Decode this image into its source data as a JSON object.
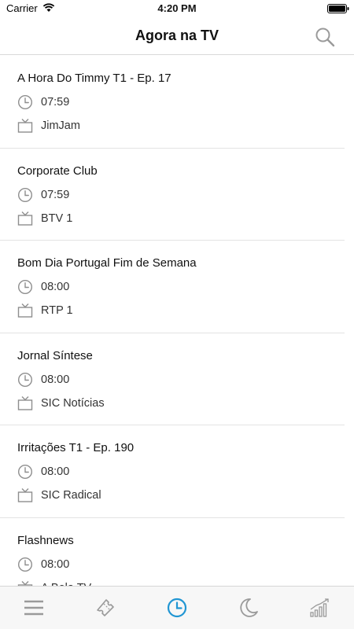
{
  "status_bar": {
    "carrier": "Carrier",
    "time": "4:20 PM"
  },
  "header": {
    "title": "Agora na TV",
    "search_icon": "search-icon"
  },
  "programs": [
    {
      "title": "A Hora Do Timmy T1 - Ep. 17",
      "time": "07:59",
      "channel": "JimJam"
    },
    {
      "title": "Corporate Club",
      "time": "07:59",
      "channel": "BTV 1"
    },
    {
      "title": "Bom Dia Portugal Fim de Semana",
      "time": "08:00",
      "channel": "RTP 1"
    },
    {
      "title": "Jornal Síntese",
      "time": "08:00",
      "channel": "SIC Notícias"
    },
    {
      "title": "Irritações T1 - Ep. 190",
      "time": "08:00",
      "channel": "SIC Radical"
    },
    {
      "title": "Flashnews",
      "time": "08:00",
      "channel": "A Bola TV"
    }
  ],
  "tab_bar": {
    "tabs": [
      "menu-icon",
      "ticket-icon",
      "clock-icon",
      "moon-icon",
      "chart-icon"
    ],
    "active": "clock-icon"
  },
  "colors": {
    "accent": "#2196d3",
    "icon_gray": "#9a9a9a",
    "divider": "#e3e3e3"
  }
}
